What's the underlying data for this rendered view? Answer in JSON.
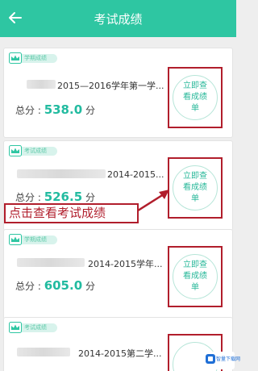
{
  "header": {
    "title": "考试成绩"
  },
  "cards": [
    {
      "badge": "学期成绩",
      "term": "2015—2016学年第一学...",
      "score_label": "总分 :",
      "score": "538.0",
      "unit": "分",
      "button_label": "立即查看成绩单"
    },
    {
      "badge": "考试成绩",
      "term": "2014-2015...",
      "score_label": "总分 :",
      "score": "526.5",
      "unit": "分",
      "button_label": "立即查看成绩单"
    },
    {
      "badge": "学期成绩",
      "term": "2014-2015学年...",
      "score_label": "总分 :",
      "score": "605.0",
      "unit": "分",
      "button_label": "立即查看成绩单"
    },
    {
      "badge": "考试成绩",
      "term": "2014-2015第二学...",
      "button_label": ""
    }
  ],
  "annotation": {
    "text": "点击查看考试成绩"
  },
  "watermark": {
    "text": "智量下载网"
  },
  "colors": {
    "accent": "#2ec6a2",
    "highlight": "#b11e2c",
    "score": "#22bba0"
  },
  "icons": {
    "back": "back-arrow-icon",
    "badge": "crown-icon"
  }
}
